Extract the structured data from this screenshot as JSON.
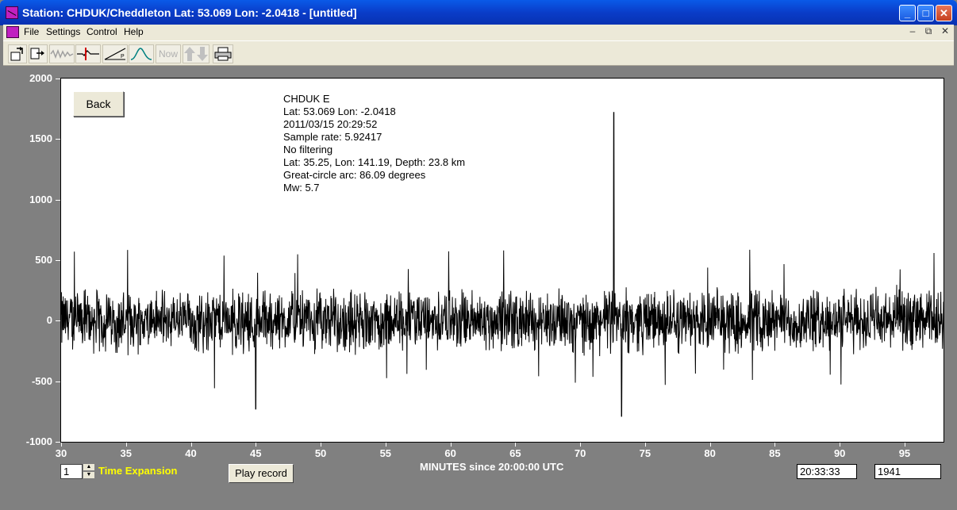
{
  "window": {
    "title": "Station: CHDUK/Cheddleton Lat: 53.069 Lon: -2.0418 - [untitled]",
    "minimize_glyph": "_",
    "maximize_glyph": "□",
    "close_glyph": "✕"
  },
  "menubar": {
    "items": [
      "File",
      "Settings",
      "Control",
      "Help"
    ],
    "mdi_buttons": [
      "–",
      "⧉",
      "✕"
    ]
  },
  "toolbar": {
    "now_label": "Now",
    "buttons": [
      "open-file-icon",
      "save-file-icon",
      "waveform-icon",
      "pick-marker-icon",
      "ramp-icon",
      "spectrum-icon",
      "now-button",
      "up-down-arrows-icon",
      "printer-icon"
    ]
  },
  "plot": {
    "back_label": "Back",
    "info": [
      "CHDUK  E",
      "Lat: 53.069 Lon: -2.0418",
      "2011/03/15 20:29:52",
      "Sample rate: 5.92417",
      "No filtering",
      "Lat: 35.25, Lon: 141.19, Depth: 23.8 km",
      "Great-circle arc: 86.09 degrees",
      "Mw: 5.7"
    ],
    "xaxis_label": "MINUTES since 20:00:00 UTC"
  },
  "chart_data": {
    "type": "line",
    "xlabel": "MINUTES since 20:00:00 UTC",
    "ylabel": "",
    "xlim": [
      30,
      98
    ],
    "ylim": [
      -1000,
      2000
    ],
    "x_ticks": [
      "30",
      "35",
      "40",
      "45",
      "50",
      "55",
      "60",
      "65",
      "70",
      "75",
      "80",
      "85",
      "90",
      "95"
    ],
    "y_ticks": [
      "2000",
      "1500",
      "1000",
      "500",
      "0",
      "-500",
      "-1000"
    ],
    "series": [
      {
        "description_points": [
          [
            30,
            0
          ],
          [
            45,
            -730
          ],
          [
            72.6,
            1720
          ],
          [
            73.2,
            -790
          ],
          [
            98,
            0
          ]
        ],
        "noise_amplitude": 300
      }
    ]
  },
  "controls": {
    "expansion_value": "1",
    "expansion_label": "Time Expansion",
    "play_record_label": "Play record",
    "time_readout": "20:33:33",
    "count_readout": "1941"
  },
  "colors": {
    "titlebar": "#0a3cc8",
    "background": "#808080",
    "plot_bg": "#ffffff",
    "trace": "#000000",
    "expansion_label": "#ffff00"
  }
}
